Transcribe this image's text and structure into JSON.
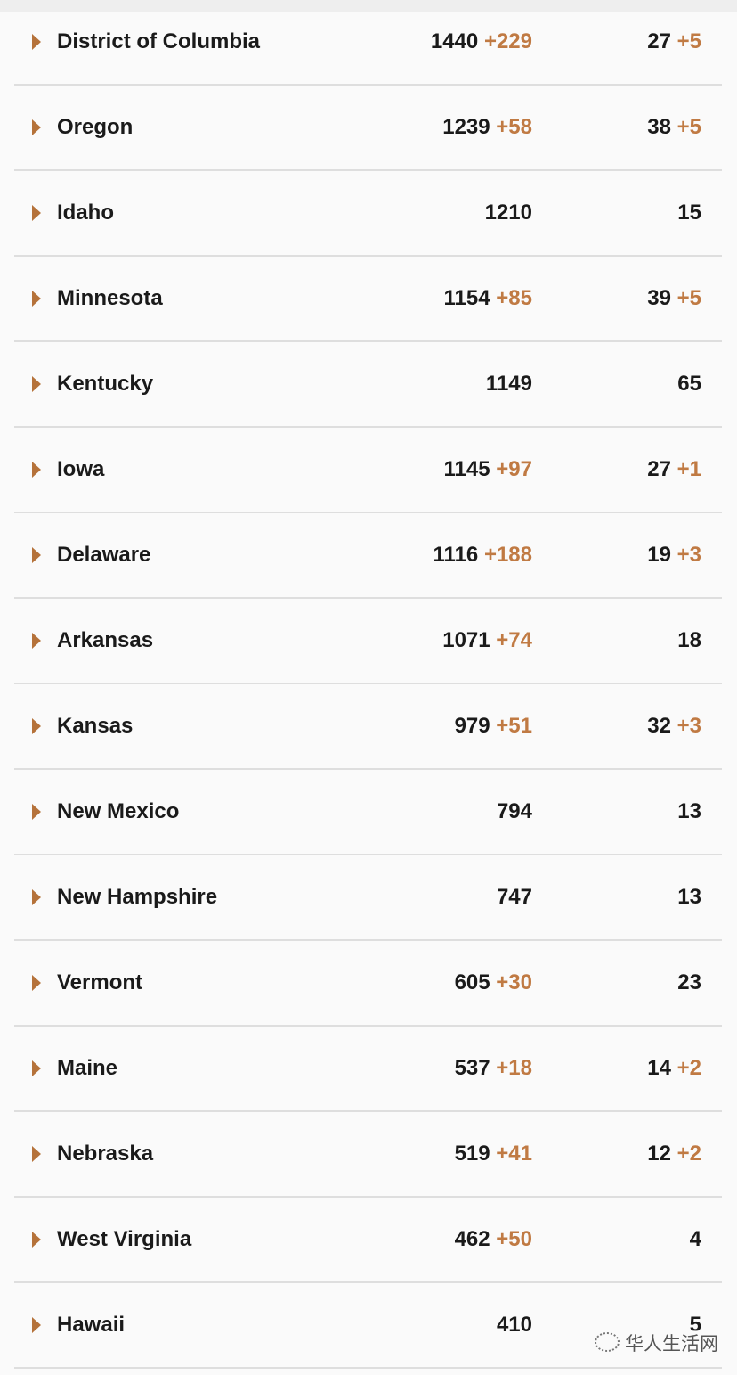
{
  "rows": [
    {
      "name": "District of Columbia",
      "cases": "1440",
      "cases_delta": "+229",
      "deaths": "27",
      "deaths_delta": "+5"
    },
    {
      "name": "Oregon",
      "cases": "1239",
      "cases_delta": "+58",
      "deaths": "38",
      "deaths_delta": "+5"
    },
    {
      "name": "Idaho",
      "cases": "1210",
      "cases_delta": "",
      "deaths": "15",
      "deaths_delta": ""
    },
    {
      "name": "Minnesota",
      "cases": "1154",
      "cases_delta": "+85",
      "deaths": "39",
      "deaths_delta": "+5"
    },
    {
      "name": "Kentucky",
      "cases": "1149",
      "cases_delta": "",
      "deaths": "65",
      "deaths_delta": ""
    },
    {
      "name": "Iowa",
      "cases": "1145",
      "cases_delta": "+97",
      "deaths": "27",
      "deaths_delta": "+1"
    },
    {
      "name": "Delaware",
      "cases": "1116",
      "cases_delta": "+188",
      "deaths": "19",
      "deaths_delta": "+3"
    },
    {
      "name": "Arkansas",
      "cases": "1071",
      "cases_delta": "+74",
      "deaths": "18",
      "deaths_delta": ""
    },
    {
      "name": "Kansas",
      "cases": "979",
      "cases_delta": "+51",
      "deaths": "32",
      "deaths_delta": "+3"
    },
    {
      "name": "New Mexico",
      "cases": "794",
      "cases_delta": "",
      "deaths": "13",
      "deaths_delta": ""
    },
    {
      "name": "New Hampshire",
      "cases": "747",
      "cases_delta": "",
      "deaths": "13",
      "deaths_delta": ""
    },
    {
      "name": "Vermont",
      "cases": "605",
      "cases_delta": "+30",
      "deaths": "23",
      "deaths_delta": ""
    },
    {
      "name": "Maine",
      "cases": "537",
      "cases_delta": "+18",
      "deaths": "14",
      "deaths_delta": "+2"
    },
    {
      "name": "Nebraska",
      "cases": "519",
      "cases_delta": "+41",
      "deaths": "12",
      "deaths_delta": "+2"
    },
    {
      "name": "West Virginia",
      "cases": "462",
      "cases_delta": "+50",
      "deaths": "4",
      "deaths_delta": ""
    },
    {
      "name": "Hawaii",
      "cases": "410",
      "cases_delta": "",
      "deaths": "5",
      "deaths_delta": ""
    }
  ],
  "watermark": {
    "text": "华人生活网",
    "icon": "wechat-icon"
  },
  "colors": {
    "accent": "#c07a43",
    "arrow": "#b5723a",
    "text": "#1a1a1a"
  }
}
